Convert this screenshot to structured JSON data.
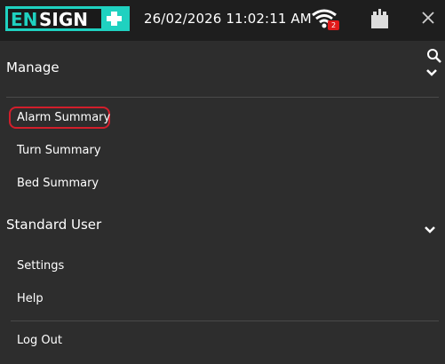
{
  "header": {
    "logo_text": "ENSIGN+",
    "datetime": "26/02/2026 11:02:11 AM",
    "wifi_badge": "2",
    "icons": {
      "wifi": "wifi-icon",
      "battery": "battery-icon",
      "close": "close-icon"
    }
  },
  "menu": {
    "manage_section": {
      "label": "Manage",
      "items": [
        {
          "label": "Alarm Summary"
        },
        {
          "label": "Turn Summary"
        },
        {
          "label": "Bed Summary"
        }
      ]
    },
    "user_section": {
      "label": "Standard User",
      "items": [
        {
          "label": "Settings"
        },
        {
          "label": "Help"
        }
      ]
    },
    "logout": {
      "label": "Log Out"
    }
  },
  "colors": {
    "brand_teal": "#1fd1c0",
    "highlight_red": "#d21e2b",
    "badge_red": "#e01a1a",
    "background": "#2d2d2d",
    "topbar": "#1e1e1e"
  }
}
